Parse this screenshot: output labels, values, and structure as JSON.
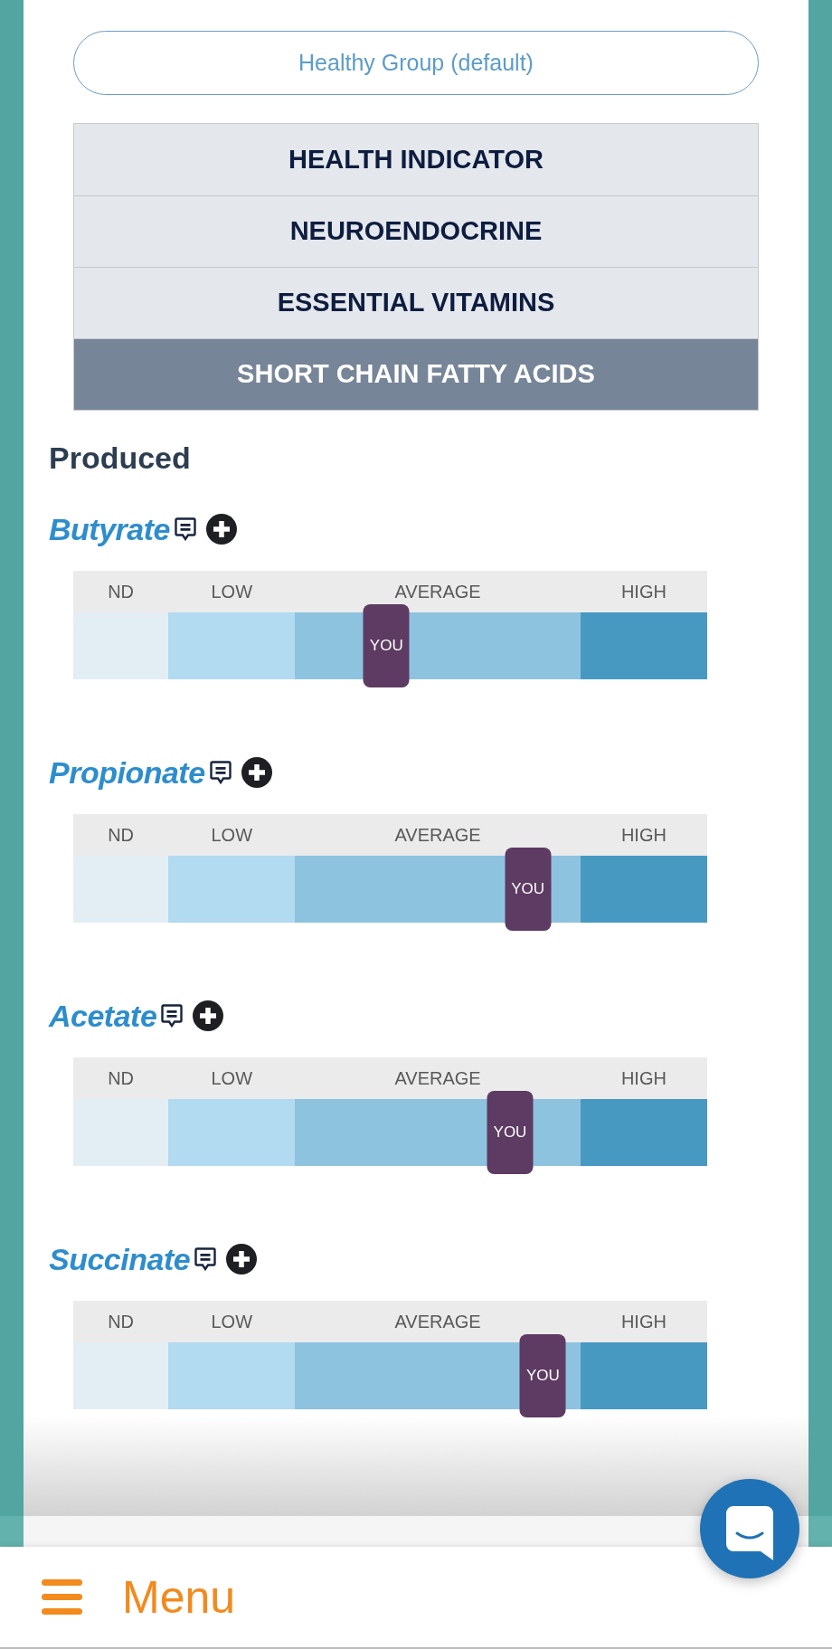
{
  "comparison_group": {
    "label": "Healthy Group (default)"
  },
  "tabs": [
    {
      "label": "HEALTH INDICATOR",
      "selected": false
    },
    {
      "label": "NEUROENDOCRINE",
      "selected": false
    },
    {
      "label": "ESSENTIAL VITAMINS",
      "selected": false
    },
    {
      "label": "SHORT CHAIN FATTY ACIDS",
      "selected": true
    }
  ],
  "section": {
    "title": "Produced",
    "markers": [
      {
        "name": "Butyrate",
        "ranges": [
          {
            "label": "ND",
            "color": "#e3edf4"
          },
          {
            "label": "LOW",
            "color": "#b2daf0"
          },
          {
            "label": "AVERAGE",
            "color": "#8ec3e0"
          },
          {
            "label": "HIGH",
            "color": "#4799c2"
          }
        ],
        "you_label": "YOU",
        "level": 0.494
      },
      {
        "name": "Propionate",
        "ranges": [
          {
            "label": "ND",
            "color": "#e3edf4"
          },
          {
            "label": "LOW",
            "color": "#b2daf0"
          },
          {
            "label": "AVERAGE",
            "color": "#8ec3e0"
          },
          {
            "label": "HIGH",
            "color": "#4799c2"
          }
        ],
        "you_label": "YOU",
        "level": 0.717
      },
      {
        "name": "Acetate",
        "ranges": [
          {
            "label": "ND",
            "color": "#e3edf4"
          },
          {
            "label": "LOW",
            "color": "#b2daf0"
          },
          {
            "label": "AVERAGE",
            "color": "#8ec3e0"
          },
          {
            "label": "HIGH",
            "color": "#4799c2"
          }
        ],
        "you_label": "YOU",
        "level": 0.689
      },
      {
        "name": "Succinate",
        "ranges": [
          {
            "label": "ND",
            "color": "#e3edf4"
          },
          {
            "label": "LOW",
            "color": "#b2daf0"
          },
          {
            "label": "AVERAGE",
            "color": "#8ec3e0"
          },
          {
            "label": "HIGH",
            "color": "#4799c2"
          }
        ],
        "you_label": "YOU",
        "level": 0.741
      }
    ]
  },
  "bottom_nav": {
    "menu_label": "Menu"
  }
}
